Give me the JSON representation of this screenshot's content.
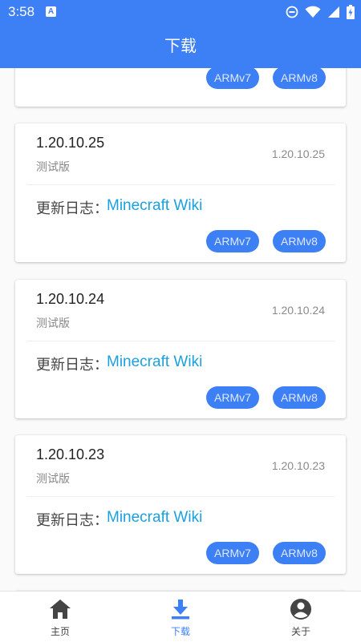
{
  "status": {
    "time": "3:58",
    "a_badge": "A"
  },
  "app_bar": {
    "title": "下载"
  },
  "partial_card": {
    "arch_buttons": [
      "ARMv7",
      "ARMv8"
    ]
  },
  "cards": [
    {
      "version": "1.20.10.25",
      "type": "测试版",
      "code": "1.20.10.25",
      "log_label": "更新日志：",
      "log_link": "Minecraft Wiki",
      "arch_buttons": [
        "ARMv7",
        "ARMv8"
      ]
    },
    {
      "version": "1.20.10.24",
      "type": "测试版",
      "code": "1.20.10.24",
      "log_label": "更新日志：",
      "log_link": "Minecraft Wiki",
      "arch_buttons": [
        "ARMv7",
        "ARMv8"
      ]
    },
    {
      "version": "1.20.10.23",
      "type": "测试版",
      "code": "1.20.10.23",
      "log_label": "更新日志：",
      "log_link": "Minecraft Wiki",
      "arch_buttons": [
        "ARMv7",
        "ARMv8"
      ]
    }
  ],
  "bottom_nav": [
    {
      "label": "主页",
      "icon": "home-icon",
      "active": false
    },
    {
      "label": "下载",
      "icon": "download-icon",
      "active": true
    },
    {
      "label": "关于",
      "icon": "account-circle-icon",
      "active": false
    }
  ],
  "colors": {
    "primary": "#3d7ff5",
    "link": "#1aa0e0",
    "nav_inactive": "#444444"
  }
}
